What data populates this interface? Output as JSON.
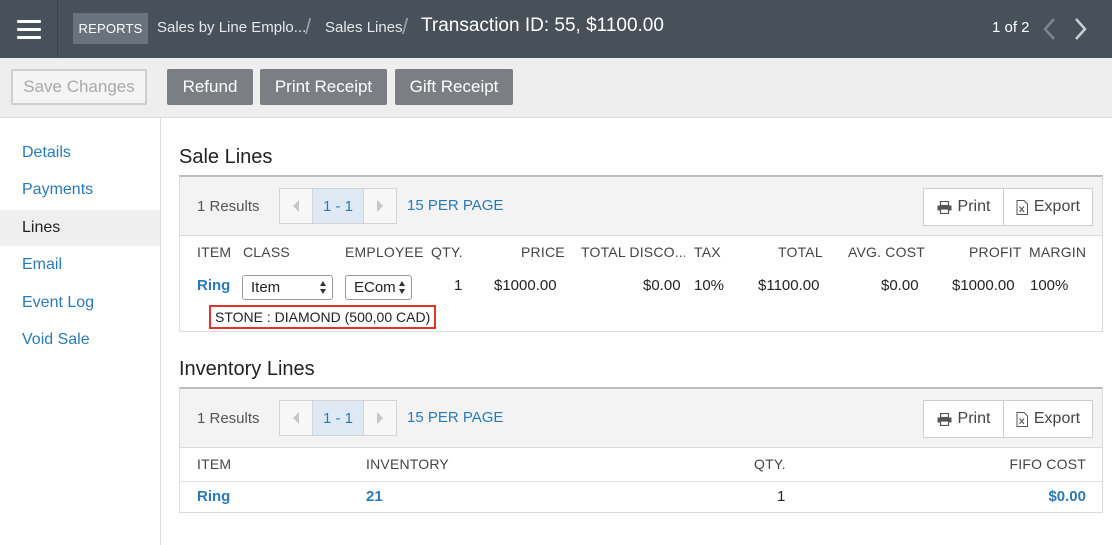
{
  "header": {
    "reports_label": "REPORTS",
    "breadcrumbs": [
      "Sales by Line Emplo...",
      "Sales Lines"
    ],
    "title": "Transaction ID: 55, $1100.00",
    "pager": "1 of 2"
  },
  "toolbar": {
    "save_label": "Save Changes",
    "refund_label": "Refund",
    "print_receipt_label": "Print Receipt",
    "gift_receipt_label": "Gift Receipt"
  },
  "sidebar": {
    "items": [
      {
        "label": "Details"
      },
      {
        "label": "Payments"
      },
      {
        "label": "Lines"
      },
      {
        "label": "Email"
      },
      {
        "label": "Event Log"
      },
      {
        "label": "Void Sale"
      }
    ],
    "active": "Lines"
  },
  "sale_lines": {
    "title": "Sale Lines",
    "results": "1 Results",
    "page_range": "1 - 1",
    "per_page": "15 PER PAGE",
    "print_label": "Print",
    "export_label": "Export",
    "columns": [
      "ITEM",
      "CLASS",
      "EMPLOYEE",
      "QTY.",
      "PRICE",
      "TOTAL DISCO...",
      "TAX",
      "TOTAL",
      "AVG. COST",
      "PROFIT",
      "MARGIN"
    ],
    "row": {
      "item": "Ring",
      "class": "Item",
      "employee": "ECom",
      "qty": "1",
      "price": "$1000.00",
      "discount": "$0.00",
      "tax": "10%",
      "total": "$1100.00",
      "avg_cost": "$0.00",
      "profit": "$1000.00",
      "margin": "100%",
      "note": "STONE : DIAMOND (500,00 CAD)"
    }
  },
  "inventory_lines": {
    "title": "Inventory Lines",
    "results": "1 Results",
    "page_range": "1 - 1",
    "per_page": "15 PER PAGE",
    "print_label": "Print",
    "export_label": "Export",
    "columns": [
      "ITEM",
      "INVENTORY",
      "QTY.",
      "FIFO COST"
    ],
    "row": {
      "item": "Ring",
      "inventory": "21",
      "qty": "1",
      "fifo_cost": "$0.00"
    }
  },
  "colors": {
    "topbar": "#48505a",
    "link": "#2a7ab8",
    "highlight": "#e0342c"
  }
}
